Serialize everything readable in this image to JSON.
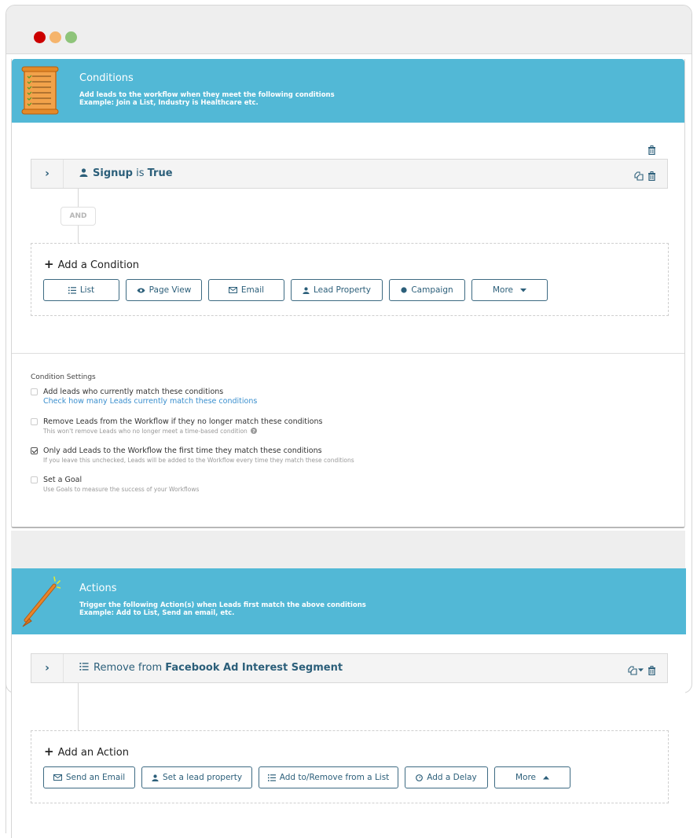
{
  "window": {
    "controls": [
      "close",
      "minimize",
      "maximize"
    ],
    "control_colors": {
      "close": "#cc0000",
      "minimize": "#f5b46c",
      "maximize": "#8ec47a"
    }
  },
  "colors": {
    "header_band": "#52b8d6",
    "accent_text": "#2c5f7a",
    "link": "#3a8fce"
  },
  "conditions": {
    "icon": "checklist-scroll-icon",
    "title": "Conditions",
    "subtitle_line1": "Add leads to the workflow when they meet the following conditions",
    "subtitle_line2": "Example: Join a List, Industry is Healthcare etc.",
    "rule": {
      "icon": "user-icon",
      "field": "Signup",
      "operator": " is ",
      "value": "True",
      "tools": [
        "copy-icon",
        "trash-icon"
      ]
    },
    "joiner": "AND",
    "add": {
      "title": "Add a Condition",
      "buttons": [
        {
          "label": "List",
          "icon": "list-icon"
        },
        {
          "label": "Page View",
          "icon": "eye-icon"
        },
        {
          "label": "Email",
          "icon": "envelope-icon"
        },
        {
          "label": "Lead Property",
          "icon": "user-icon"
        },
        {
          "label": "Campaign",
          "icon": "circle-icon"
        },
        {
          "label": "More",
          "icon": "caret-down-icon"
        }
      ]
    },
    "settings": {
      "heading": "Condition Settings",
      "items": [
        {
          "label": "Add leads who currently match these conditions",
          "link": "Check how many Leads currently match these conditions",
          "checked": false
        },
        {
          "label": "Remove Leads from the Workflow if they no longer match these conditions",
          "hint": "This won't remove Leads who no longer meet a time-based condition",
          "checked": false
        },
        {
          "label": "Only add Leads to the Workflow the first time they match these conditions",
          "hint": "If you leave this unchecked, Leads will be added to the Workflow every time they match these conditions",
          "checked": true
        },
        {
          "label": "Set a Goal",
          "hint": "Use Goals to measure the success of your Workflows",
          "checked": false
        }
      ]
    }
  },
  "actions": {
    "icon": "magic-wand-icon",
    "title": "Actions",
    "subtitle_line1": "Trigger the following Action(s) when Leads first match the above conditions",
    "subtitle_line2": "Example: Add to List, Send an email, etc.",
    "rule": {
      "icon": "list-icon",
      "verb": "Remove from ",
      "target": "Facebook Ad Interest Segment",
      "tools": [
        "copy-icon",
        "caret-down-icon",
        "trash-icon"
      ]
    },
    "add": {
      "title": "Add an Action",
      "buttons": [
        {
          "label": "Send an Email",
          "icon": "envelope-icon"
        },
        {
          "label": "Set a lead property",
          "icon": "user-icon"
        },
        {
          "label": "Add to/Remove from a List",
          "icon": "list-icon"
        },
        {
          "label": "Add a Delay",
          "icon": "clock-icon"
        },
        {
          "label": "More",
          "icon": "caret-up-icon"
        }
      ]
    }
  }
}
